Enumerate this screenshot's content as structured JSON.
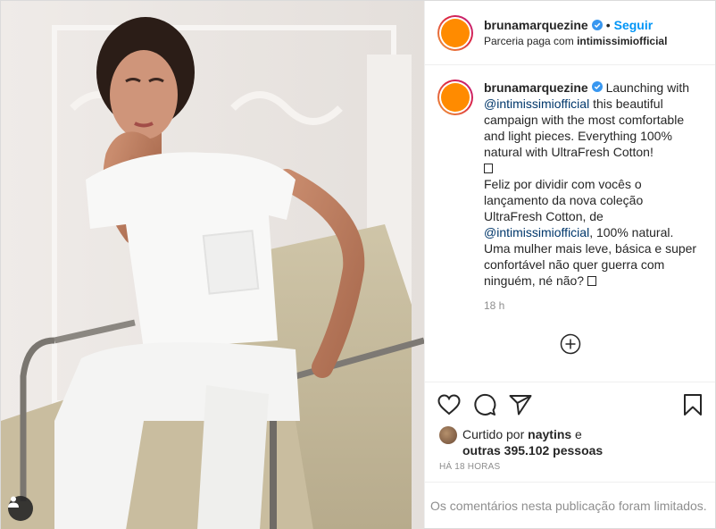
{
  "post": {
    "username": "brunamarquezine",
    "follow_label": "Seguir",
    "bullet": "•",
    "partnership_prefix": "Parceria paga com",
    "partner": "intimissimiofficial"
  },
  "caption": {
    "username": "brunamarquezine",
    "part1": " Launching with ",
    "mention1": "@intimissimiofficial",
    "part2": " this beautiful campaign with the most comfortable and light pieces. Everything 100% natural with UltraFresh Cotton!",
    "part3": "Feliz por dividir com vocês o lançamento da nova coleção UltraFresh Cotton, de ",
    "mention2": "@intimissimiofficial",
    "part4": ", 100% natural. Uma mulher mais leve, básica e super confortável não quer guerra com ninguém, né não? ",
    "time": "18 h"
  },
  "likes": {
    "prefix": "Curtido por ",
    "liker": "naytins",
    "middle": " e",
    "others": "outras 395.102 pessoas"
  },
  "posted_ago": "HÁ 18 HORAS",
  "comments_limited": "Os comentários nesta publicação foram limitados.",
  "icons": {
    "verified": "verified-badge-icon",
    "like": "heart-icon",
    "comment": "comment-bubble-icon",
    "share": "paper-plane-icon",
    "save": "bookmark-icon",
    "load_more": "plus-circle-icon",
    "user_tag": "person-icon"
  },
  "colors": {
    "accent": "#0095f6",
    "avatar": "#ff8b00",
    "mention": "#00376b",
    "muted": "#8e8e8e"
  }
}
